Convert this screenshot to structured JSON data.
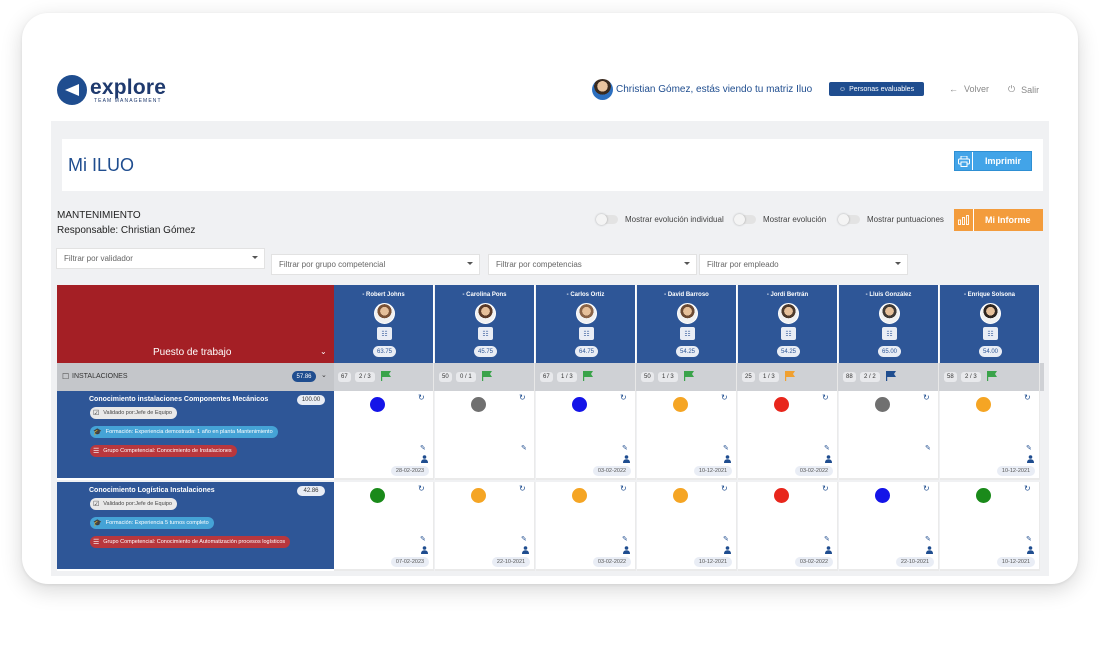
{
  "app": {
    "brand": "explore",
    "brand_sub": "TEAM MANAGEMENT",
    "user_message": "Christian Gómez, estás viendo tu matriz Iluo",
    "persons_button": "Personas evaluables",
    "back_label": "Volver",
    "exit_label": "Salir"
  },
  "page": {
    "title": "Mi ILUO",
    "print_label": "Imprimir",
    "area": "MANTENIMIENTO",
    "responsible": "Responsable: Christian Gómez",
    "report_label": "Mi Informe"
  },
  "toggles": [
    {
      "label": "Mostrar evolución individual"
    },
    {
      "label": "Mostrar evolución"
    },
    {
      "label": "Mostrar puntuaciones"
    }
  ],
  "filters": [
    {
      "placeholder": "Filtrar por validador"
    },
    {
      "placeholder": "Filtrar por grupo competencial"
    },
    {
      "placeholder": "Filtrar por competencias"
    },
    {
      "placeholder": "Filtrar por empleado"
    }
  ],
  "matrix": {
    "header_label": "Puesto de trabajo",
    "employees": [
      {
        "name": "- Robert Johns",
        "score": "63.75",
        "avatar_color": "#7a5236"
      },
      {
        "name": "- Carolina Pons",
        "score": "45.75",
        "avatar_color": "#5a3a28"
      },
      {
        "name": "- Carlos Ortiz",
        "score": "64.75",
        "avatar_color": "#8a6448"
      },
      {
        "name": "- David Barroso",
        "score": "54.25",
        "avatar_color": "#6b4a34"
      },
      {
        "name": "- Jordi Bertrán",
        "score": "54.25",
        "avatar_color": "#4d3a2c"
      },
      {
        "name": "- Lluis González",
        "score": "65.00",
        "avatar_color": "#3f3a36"
      },
      {
        "name": "- Enrique Solsona",
        "score": "54.00",
        "avatar_color": "#2d2520"
      }
    ],
    "group": {
      "label": "INSTALACIONES",
      "score": "57.86",
      "cells": [
        {
          "a": "67",
          "b": "2 / 3",
          "flag": "#3aa34a"
        },
        {
          "a": "50",
          "b": "0 / 1",
          "flag": "#3aa34a"
        },
        {
          "a": "67",
          "b": "1 / 3",
          "flag": "#3aa34a"
        },
        {
          "a": "50",
          "b": "1 / 3",
          "flag": "#3aa34a"
        },
        {
          "a": "25",
          "b": "1 / 3",
          "flag": "#f0a030"
        },
        {
          "a": "88",
          "b": "2 / 2",
          "flag": "#1f4d8f"
        },
        {
          "a": "58",
          "b": "2 / 3",
          "flag": "#3aa34a"
        }
      ]
    },
    "competencies": [
      {
        "name": "Conocimiento instalaciones Componentes Mecánicos",
        "weight": "100.00",
        "validator": "Validado por:Jefe de Equipo",
        "training": "Formación: Experiencia demostrada: 1 año en planta Mantenimiento",
        "group": "Grupo Competencial: Conocimiento de Instalaciones",
        "cells": [
          {
            "color": "#1414e8",
            "date": "28-02-2023"
          },
          {
            "color": "#707070",
            "date": ""
          },
          {
            "color": "#1414e8",
            "date": "03-02-2022"
          },
          {
            "color": "#f5a524",
            "date": "10-12-2021"
          },
          {
            "color": "#e8261c",
            "date": "03-02-2022"
          },
          {
            "color": "#707070",
            "date": ""
          },
          {
            "color": "#f5a524",
            "date": "10-12-2021"
          }
        ]
      },
      {
        "name": "Conocimiento Logística Instalaciones",
        "weight": "42.86",
        "validator": "Validado por:Jefe de Equipo",
        "training": "Formación: Experiencia 5 turnos completo",
        "group": "Grupo Competencial: Conocimiento de Automatización procesos logísticos",
        "cells": [
          {
            "color": "#1a8a1a",
            "date": "07-02-2023"
          },
          {
            "color": "#f5a524",
            "date": "22-10-2021"
          },
          {
            "color": "#f5a524",
            "date": "03-02-2022"
          },
          {
            "color": "#f5a524",
            "date": "10-12-2021"
          },
          {
            "color": "#e8261c",
            "date": "03-02-2022"
          },
          {
            "color": "#1414e8",
            "date": "22-10-2021"
          },
          {
            "color": "#1a8a1a",
            "date": "10-12-2021"
          }
        ]
      }
    ]
  }
}
